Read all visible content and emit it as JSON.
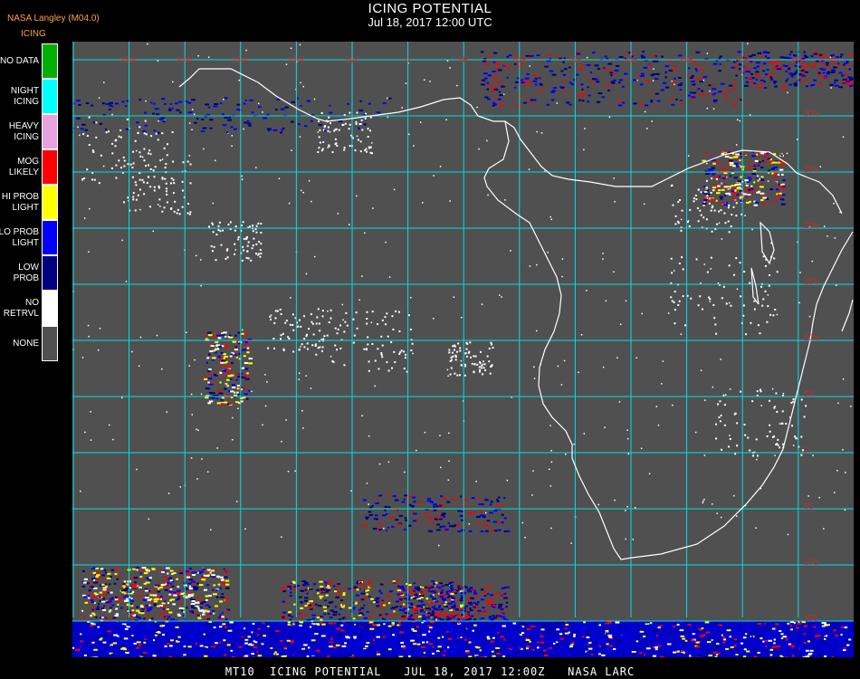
{
  "header": {
    "title": "ICING POTENTIAL",
    "subtitle": "Jul 18, 2017 12:00 UTC",
    "producer": "NASA Langley (M04.0)",
    "product": "ICING"
  },
  "legend": [
    {
      "label": "NO DATA",
      "color": "#00b000"
    },
    {
      "label": "NIGHT\nICING",
      "color": "#00ffff"
    },
    {
      "label": "HEAVY\nICING",
      "color": "#e8a0e0"
    },
    {
      "label": "MOG\nLIKELY",
      "color": "#ff0000"
    },
    {
      "label": "HI PROB\nLIGHT",
      "color": "#ffff00"
    },
    {
      "label": "LO PROB\nLIGHT",
      "color": "#0000ff"
    },
    {
      "label": "LOW\nPROB",
      "color": "#000080"
    },
    {
      "label": "NO\nRETRVL",
      "color": "#ffffff"
    },
    {
      "label": "NONE",
      "color": "#505050"
    }
  ],
  "map": {
    "background_color": "#505050",
    "grid_color": "#00e0e0",
    "coast_color": "#ffffff"
  },
  "footer": "MT10  ICING POTENTIAL   JUL 18, 2017 12:00Z   NASA LARC"
}
